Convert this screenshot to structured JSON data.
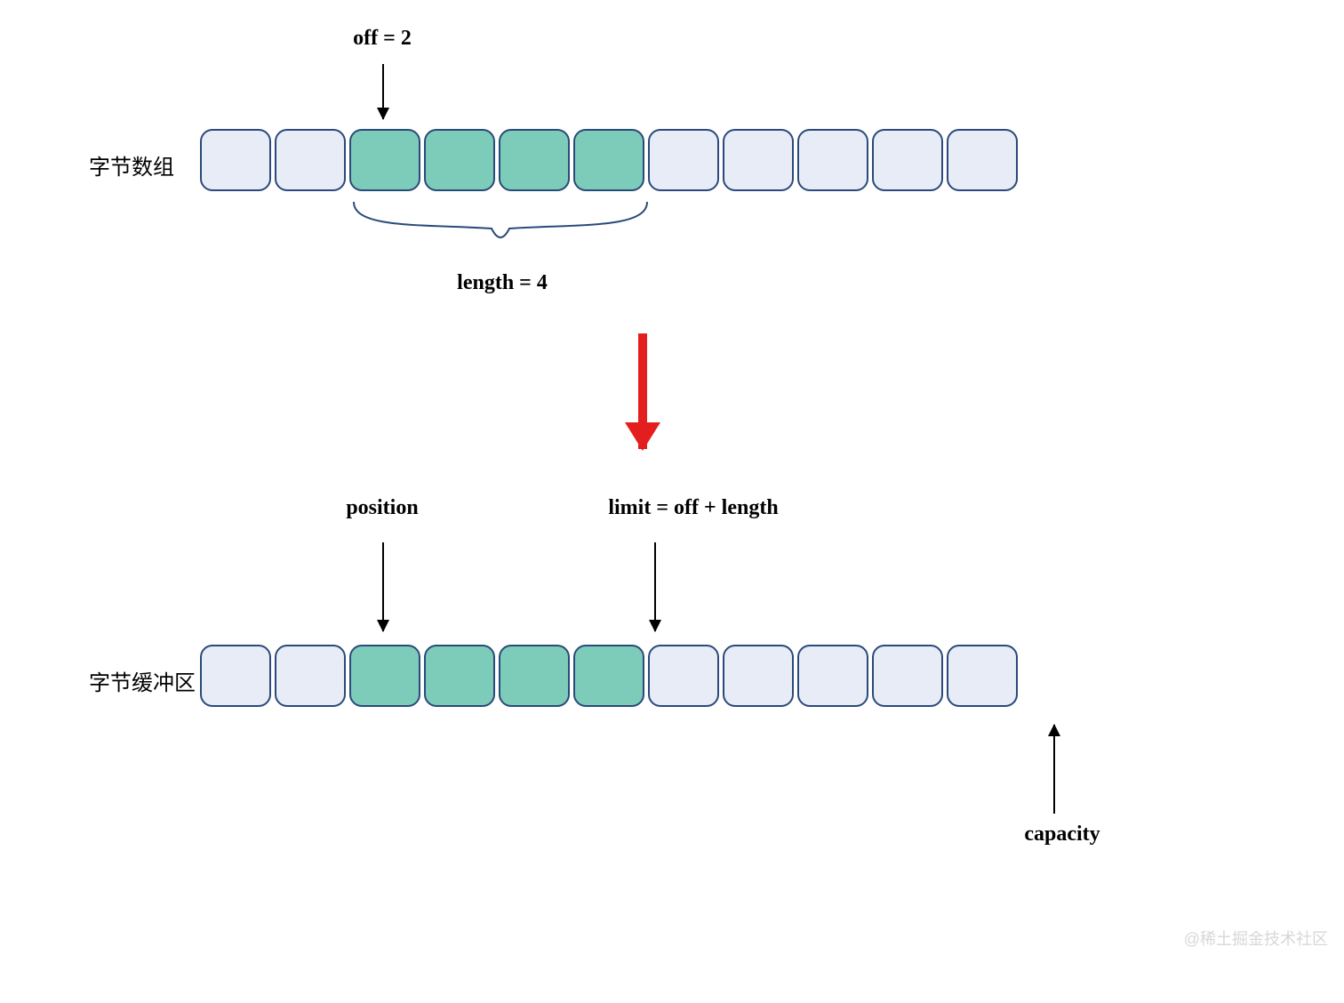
{
  "labels": {
    "row1": "字节数组",
    "row2": "字节缓冲区",
    "off": "off = 2",
    "length": "length = 4",
    "position": "position",
    "limit": "limit = off + length",
    "capacity": "capacity"
  },
  "diagram": {
    "total_cells": 11,
    "highlight_start": 2,
    "highlight_count": 4,
    "off_value": 2,
    "length_value": 4
  },
  "watermark": "@稀土掘金技术社区",
  "colors": {
    "cell_border": "#2a4a7a",
    "cell_plain": "#e7ecf6",
    "cell_highlight": "#7dccb9",
    "flow_arrow": "#e41e1e"
  }
}
